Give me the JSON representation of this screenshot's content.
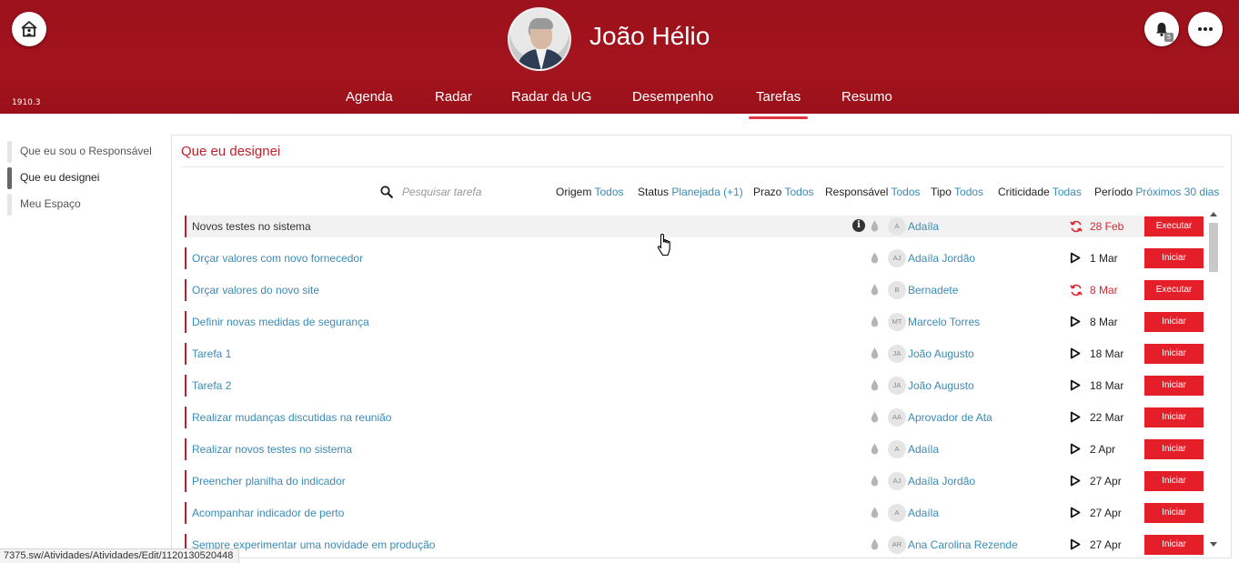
{
  "header": {
    "version": "1910.3",
    "user_name": "João Hélio",
    "notification_count": "5",
    "nav": [
      {
        "label": "Agenda"
      },
      {
        "label": "Radar"
      },
      {
        "label": "Radar da UG"
      },
      {
        "label": "Desempenho"
      },
      {
        "label": "Tarefas",
        "active": true
      },
      {
        "label": "Resumo"
      }
    ]
  },
  "sidebar": {
    "items": [
      {
        "label": "Que eu sou o Responsável"
      },
      {
        "label": "Que eu designei",
        "active": true
      },
      {
        "label": "Meu Espaço"
      }
    ]
  },
  "panel": {
    "title": "Que eu designei",
    "search_placeholder": "Pesquisar tarefa",
    "filters": [
      {
        "key": "Origem",
        "value": "Todos"
      },
      {
        "key": "Status",
        "value": "Planejada (+1)"
      },
      {
        "key": "Prazo",
        "value": "Todos"
      },
      {
        "key": "Responsável",
        "value": "Todos"
      },
      {
        "key": "Tipo",
        "value": "Todos"
      },
      {
        "key": "Criticidade",
        "value": "Todas"
      },
      {
        "key": "Período",
        "value": "Próximos 30 dias"
      }
    ]
  },
  "tasks": [
    {
      "title": "Novos testes no sistema",
      "initials": "A",
      "responsible": "Adaíla",
      "date": "28 Feb",
      "late": true,
      "action": "Executar",
      "info": true
    },
    {
      "title": "Orçar valores com novo fornecedor",
      "initials": "AJ",
      "responsible": "Adaíla Jordão",
      "date": "1 Mar",
      "late": false,
      "action": "Iniciar"
    },
    {
      "title": "Orçar valores do novo site",
      "initials": "B",
      "responsible": "Bernadete",
      "date": "8 Mar",
      "late": true,
      "action": "Executar"
    },
    {
      "title": "Definir novas medidas de segurança",
      "initials": "MT",
      "responsible": "Marcelo Torres",
      "date": "8 Mar",
      "late": false,
      "action": "Iniciar"
    },
    {
      "title": "Tarefa 1",
      "initials": "JA",
      "responsible": "João Augusto",
      "date": "18 Mar",
      "late": false,
      "action": "Iniciar"
    },
    {
      "title": "Tarefa 2",
      "initials": "JA",
      "responsible": "João Augusto",
      "date": "18 Mar",
      "late": false,
      "action": "Iniciar"
    },
    {
      "title": "Realizar mudanças discutidas na reunião",
      "initials": "AA",
      "responsible": "Aprovador de Ata",
      "date": "22 Mar",
      "late": false,
      "action": "Iniciar"
    },
    {
      "title": "Realizar novos testes no sistema",
      "initials": "A",
      "responsible": "Adaíla",
      "date": "2 Apr",
      "late": false,
      "action": "Iniciar"
    },
    {
      "title": "Preencher planilha do indicador",
      "initials": "AJ",
      "responsible": "Adaíla Jordão",
      "date": "27 Apr",
      "late": false,
      "action": "Iniciar"
    },
    {
      "title": "Acompanhar indicador de perto",
      "initials": "A",
      "responsible": "Adaíla",
      "date": "27 Apr",
      "late": false,
      "action": "Iniciar"
    },
    {
      "title": "Sempre experimentar uma novidade em produção",
      "initials": "AR",
      "responsible": "Ana Carolina Rezende",
      "date": "27 Apr",
      "late": false,
      "action": "Iniciar"
    }
  ],
  "statusbar": {
    "url": "7375.sw/Atividades/Atividades/Edit/1120130520448"
  },
  "colors": {
    "brand_red": "#a3141e",
    "accent_red": "#e51f2a",
    "link_blue": "#3a8bb5",
    "late_red": "#d9252f"
  }
}
